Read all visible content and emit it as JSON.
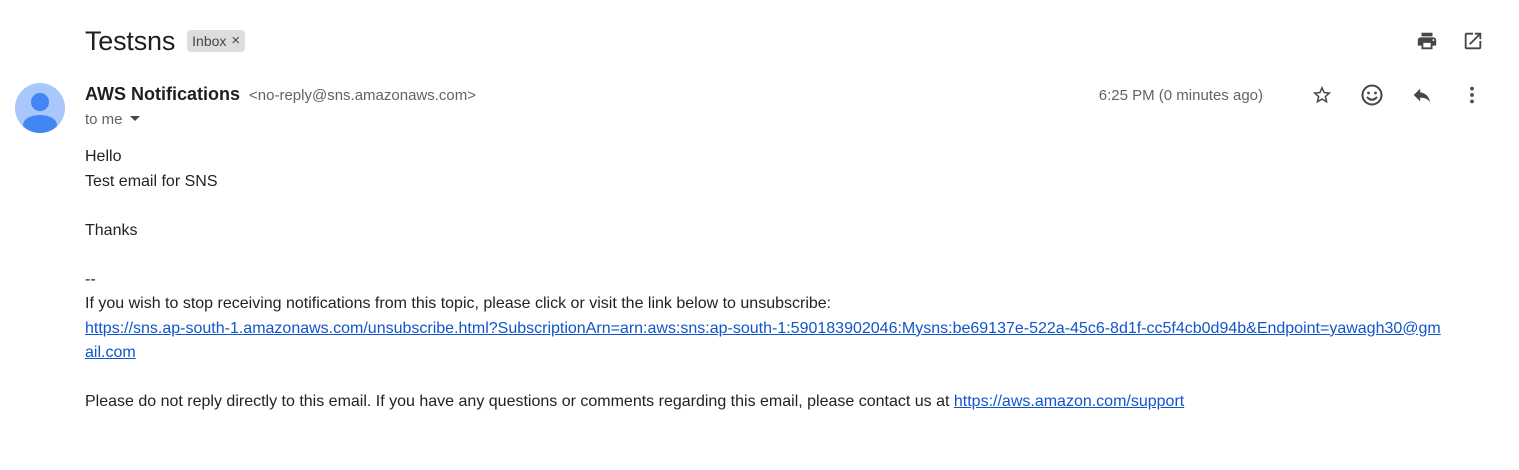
{
  "email": {
    "subject": "Testsns",
    "label": "Inbox",
    "label_remove": "×",
    "sender_name": "AWS Notifications",
    "sender_email": "<no-reply@sns.amazonaws.com>",
    "recipient": "to me",
    "timestamp": "6:25 PM (0 minutes ago)"
  },
  "body": {
    "greeting": "Hello",
    "line1": "Test email for SNS",
    "thanks": "Thanks",
    "separator": "--",
    "unsub_text": "If you wish to stop receiving notifications from this topic, please click or visit the link below to unsubscribe:",
    "unsub_link": "https://sns.ap-south-1.amazonaws.com/unsubscribe.html?SubscriptionArn=arn:aws:sns:ap-south-1:590183902046:Mysns:be69137e-522a-45c6-8d1f-cc5f4cb0d94b&Endpoint=yawagh30@gmail.com",
    "footer_text": "Please do not reply directly to this email. If you have any questions or comments regarding this email, please contact us at ",
    "footer_link": "https://aws.amazon.com/support"
  },
  "icons": {
    "print": "print-icon",
    "popout": "open-in-new-window-icon",
    "star": "star-icon",
    "emoji": "emoji-icon",
    "reply": "reply-icon",
    "more": "more-vert-icon",
    "caret": "caret-down-icon",
    "avatar": "person-avatar-icon"
  },
  "colors": {
    "link": "#1155cc",
    "avatar_bg": "#a8c7fa",
    "avatar_fg": "#4285f4",
    "label_chip": "#dddddd"
  }
}
